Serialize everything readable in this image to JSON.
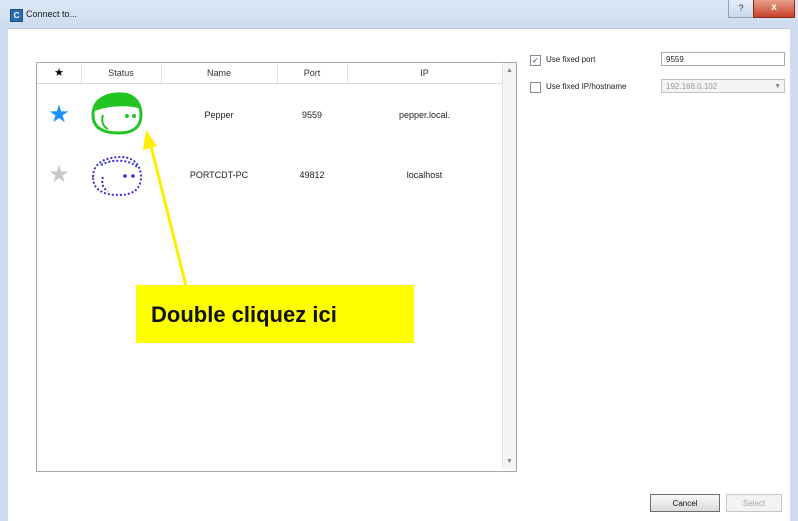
{
  "window": {
    "title": "Connect to...",
    "help_label": "?",
    "close_label": "x",
    "app_icon_letter": "C"
  },
  "table": {
    "headers": {
      "favorite": "★",
      "status": "Status",
      "name": "Name",
      "port": "Port",
      "ip": "IP"
    },
    "rows": [
      {
        "favorite": "★",
        "favorite_color": "#1e90ff",
        "favorited": true,
        "status_icon": "robot-head-connected-icon",
        "status_color": "#22c422",
        "name": "Pepper",
        "port": "9559",
        "ip": "pepper.local."
      },
      {
        "favorite": "★",
        "favorite_color": "#c8c8c8",
        "favorited": false,
        "status_icon": "robot-head-offline-icon",
        "status_color": "#3a2fd6",
        "name": "PORTCDT-PC",
        "port": "49812",
        "ip": "localhost"
      }
    ]
  },
  "options": {
    "fixed_port": {
      "label": "Use fixed port",
      "checked": true,
      "value": "9559"
    },
    "fixed_ip": {
      "label": "Use fixed IP/hostname",
      "checked": false,
      "value": "192.168.0.102"
    }
  },
  "callout": {
    "text": "Double cliquez ici",
    "color": "#ffff00",
    "arrow_color": "#ffee00"
  },
  "buttons": {
    "cancel": "Cancel",
    "select": "Select"
  }
}
